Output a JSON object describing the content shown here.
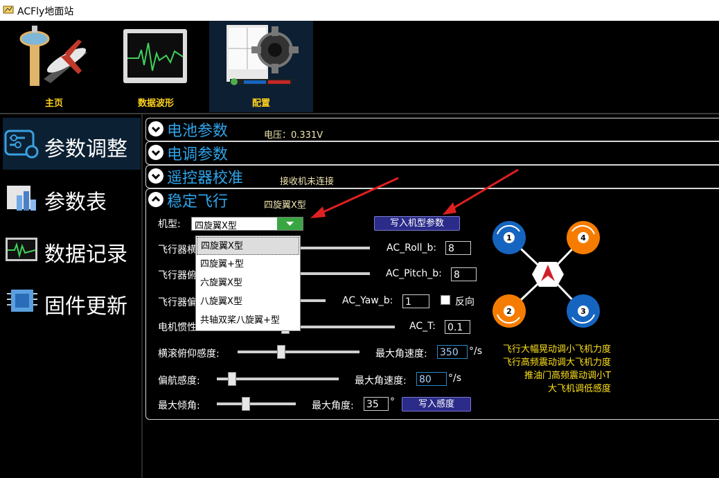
{
  "window": {
    "title": "ACFly地面站"
  },
  "toolbar": {
    "items": [
      {
        "label": "主页"
      },
      {
        "label": "数据波形"
      },
      {
        "label": "配置"
      }
    ]
  },
  "sidebar": {
    "items": [
      {
        "label": "参数调整"
      },
      {
        "label": "参数表"
      },
      {
        "label": "数据记录"
      },
      {
        "label": "固件更新"
      }
    ]
  },
  "sections": {
    "battery": {
      "title": "电池参数",
      "note": "电压：0.331V"
    },
    "esc": {
      "title": "电调参数"
    },
    "rc": {
      "title": "遥控器校准",
      "note": "接收机未连接"
    },
    "stable": {
      "title": "稳定飞行",
      "note": "四旋翼X型"
    }
  },
  "frame": {
    "label": "机型:",
    "value": "四旋翼X型",
    "write_button": "写入机型参数",
    "options": [
      "四旋翼X型",
      "四旋翼+型",
      "六旋翼X型",
      "八旋翼X型",
      "共轴双桨八旋翼+型"
    ]
  },
  "params": {
    "label1": "飞行器横",
    "label2": "飞行器俯",
    "label3": "飞行器偏",
    "label4": "电机惯性",
    "ac_roll_label": "AC_Roll_b:",
    "ac_roll_value": "8",
    "ac_pitch_label": "AC_Pitch_b:",
    "ac_pitch_value": "8",
    "ac_yaw_label": "AC_Yaw_b:",
    "ac_yaw_value": "1",
    "reverse_label": "反向",
    "ac_t_label": "AC_T:",
    "ac_t_value": "0.1",
    "rp_sens_label": "横滚俯仰感度:",
    "rp_max_rate_label": "最大角速度:",
    "rp_max_rate_value": "350",
    "rp_unit": "°/s",
    "yaw_sens_label": "偏航感度:",
    "yaw_max_rate_label": "最大角速度:",
    "yaw_max_rate_value": "80",
    "yaw_unit": "°/s",
    "max_tilt_label": "最大倾角:",
    "max_angle_label": "最大角度:",
    "max_angle_value": "35",
    "angle_unit": "°",
    "write_sens_button": "写入感度",
    "rp_sens_level": 0.35,
    "yaw_sens_level": 0.1,
    "tilt_level": 0.35
  },
  "motors": [
    "1",
    "4",
    "2",
    "3"
  ],
  "hints": [
    "飞行大幅晃动调小飞机力度",
    "飞行高频震动调大飞机力度",
    "推油门高频震动调小T",
    "大飞机调低感度"
  ],
  "colors": {
    "accent": "#2fa4ea",
    "motor_blue": "#1565c0",
    "motor_orange": "#f57c00",
    "hint": "#ffe21c"
  }
}
